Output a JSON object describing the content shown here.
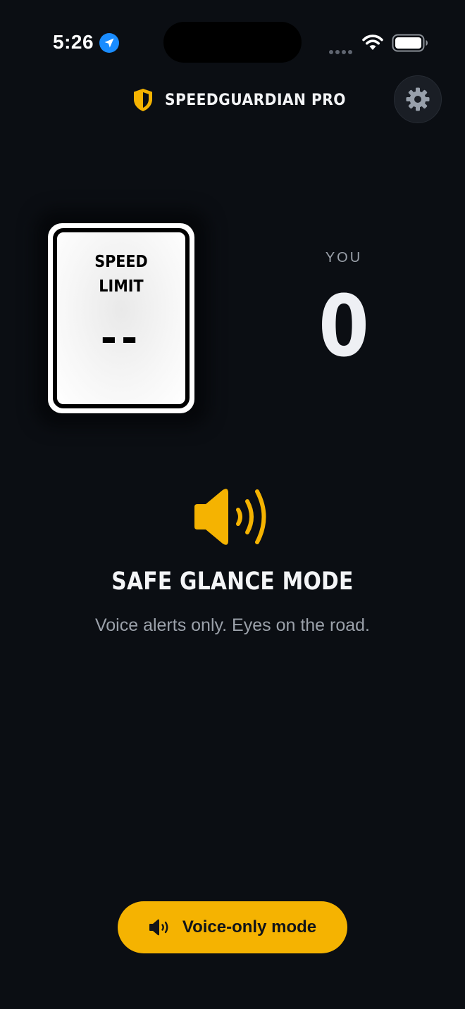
{
  "status_bar": {
    "time": "5:26",
    "icons": [
      "location-arrow-icon",
      "signal-dots-icon",
      "wifi-icon",
      "battery-icon"
    ]
  },
  "header": {
    "title": "SPEEDGUARDIAN PRO",
    "logo_icon": "shield-icon",
    "settings_icon": "gear-icon"
  },
  "speed_limit_sign": {
    "label_line1": "SPEED",
    "label_line2": "LIMIT",
    "value": "--"
  },
  "current_speed": {
    "label": "YOU",
    "value": "0"
  },
  "mode": {
    "icon": "speaker-icon",
    "title": "SAFE GLANCE MODE",
    "subtitle": "Voice alerts only. Eyes on the road."
  },
  "bottom_button": {
    "icon": "speaker-icon",
    "label": "Voice-only mode"
  },
  "colors": {
    "background": "#0b0e13",
    "accent": "#f5b301",
    "text_primary": "#f4f5f7",
    "text_secondary": "#9ba1aa",
    "location_blue": "#1a8cff"
  }
}
